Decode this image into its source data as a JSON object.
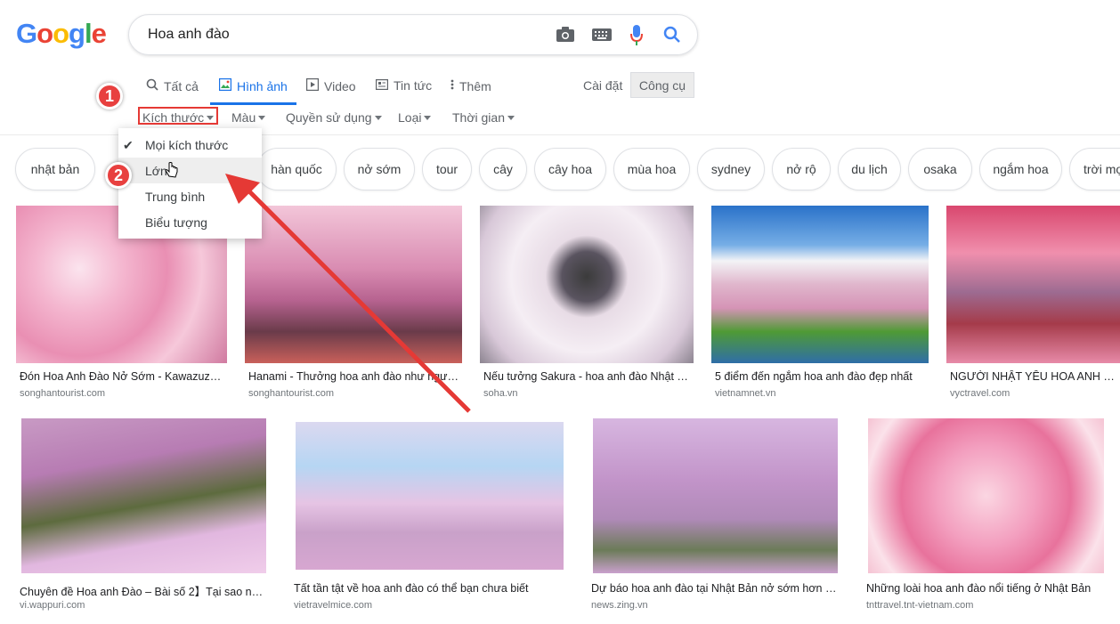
{
  "logo": "Google",
  "search": {
    "query": "Hoa anh đào"
  },
  "tabs": [
    {
      "label": "Tất cả",
      "icon": "search-icon"
    },
    {
      "label": "Hình ảnh",
      "icon": "image-icon",
      "active": true
    },
    {
      "label": "Video",
      "icon": "video-icon"
    },
    {
      "label": "Tin tức",
      "icon": "news-icon"
    },
    {
      "label": "Thêm",
      "icon": "more-icon"
    }
  ],
  "settings_label": "Cài đặt",
  "tools_label": "Công cụ",
  "filters": [
    "Kích thước",
    "Màu",
    "Quyền sử dụng",
    "Loại",
    "Thời gian"
  ],
  "dropdown": {
    "items": [
      "Mọi kích thước",
      "Lớn",
      "Trung bình",
      "Biểu tượng"
    ],
    "selected": "Mọi kích thước"
  },
  "chips": [
    "nhật bản",
    "hàn quốc",
    "nở sớm",
    "tour",
    "cây",
    "cây hoa",
    "mùa hoa",
    "sydney",
    "nở rộ",
    "du lịch",
    "osaka",
    "ngắm hoa",
    "trời mọ"
  ],
  "results_row1": [
    {
      "caption": "Đón Hoa Anh Đào Nở Sớm - Kawazuzak…",
      "source": "songhantourist.com"
    },
    {
      "caption": "Hanami - Thưởng hoa anh đào như người…",
      "source": "songhantourist.com"
    },
    {
      "caption": "Nếu tưởng Sakura - hoa anh đào Nhật B…",
      "source": "soha.vn"
    },
    {
      "caption": "5 điểm đến ngắm hoa anh đào đẹp nhất",
      "source": "vietnamnet.vn"
    },
    {
      "caption": "NGƯỜI NHẬT YÊU HOA ANH ĐÀO Đ",
      "source": "vyctravel.com"
    }
  ],
  "results_row2": [
    {
      "caption": "Chuyên đề Hoa anh Đào – Bài số 2】Tại sao ngư…",
      "source": "vi.wappuri.com"
    },
    {
      "caption": "Tất tần tật về hoa anh đào có thể bạn chưa biết",
      "source": "vietravelmice.com"
    },
    {
      "caption": "Dự báo hoa anh đào tại Nhật Bản nở sớm hơn m…",
      "source": "news.zing.vn"
    },
    {
      "caption": "Những loài hoa anh đào nổi tiếng ở Nhật Bản",
      "source": "tnttravel.tnt-vietnam.com"
    }
  ],
  "annotations": {
    "badge1": "1",
    "badge2": "2"
  },
  "colors": {
    "accent": "#1a73e8",
    "annotation_red": "#e53935"
  }
}
